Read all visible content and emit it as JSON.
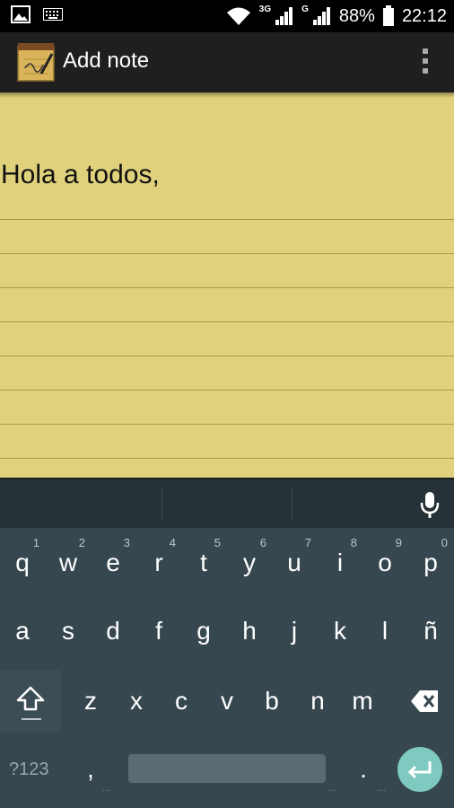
{
  "status_bar": {
    "network_3g": "3G",
    "network_g": "G",
    "battery_percent": "88%",
    "time": "22:12"
  },
  "action_bar": {
    "title": "Add note",
    "app_icon": "notepad-icon",
    "menu_icon": "overflow-menu-icon"
  },
  "note": {
    "text": "Hola a todos,"
  },
  "keyboard": {
    "row1": [
      {
        "label": "q",
        "hint": "1"
      },
      {
        "label": "w",
        "hint": "2"
      },
      {
        "label": "e",
        "hint": "3"
      },
      {
        "label": "r",
        "hint": "4"
      },
      {
        "label": "t",
        "hint": "5"
      },
      {
        "label": "y",
        "hint": "6"
      },
      {
        "label": "u",
        "hint": "7"
      },
      {
        "label": "i",
        "hint": "8"
      },
      {
        "label": "o",
        "hint": "9"
      },
      {
        "label": "p",
        "hint": "0"
      }
    ],
    "row2": [
      "a",
      "s",
      "d",
      "f",
      "g",
      "h",
      "j",
      "k",
      "l",
      "ñ"
    ],
    "row3": [
      "z",
      "x",
      "c",
      "v",
      "b",
      "n",
      "m"
    ],
    "symbols_label": "?123",
    "comma_label": ",",
    "period_label": ".",
    "colors": {
      "background": "#37474f",
      "suggestion_strip": "#263238",
      "enter_accent": "#7ecac1",
      "note_paper": "#e0d17c"
    }
  }
}
